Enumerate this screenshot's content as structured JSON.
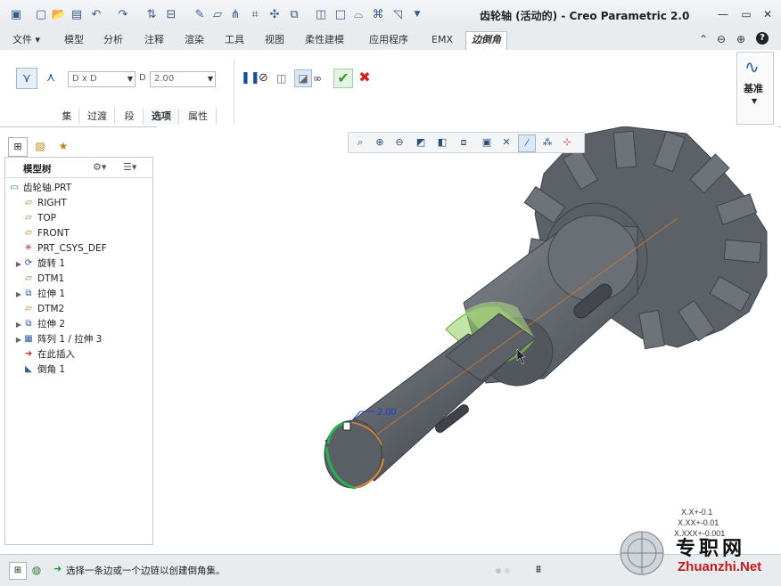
{
  "app": {
    "title": "齿轮轴 (活动的) - Creo Parametric 2.0"
  },
  "ribbon": {
    "file_label": "文件",
    "tabs": [
      "模型",
      "分析",
      "注释",
      "渲染",
      "工具",
      "视图",
      "柔性建模",
      "应用程序",
      "EMX"
    ],
    "active_tab": "边倒角"
  },
  "dashboard": {
    "dim_scheme": "D x D",
    "d_label": "D",
    "d_value": "2.00",
    "subtabs": [
      "集",
      "过渡",
      "段",
      "选项",
      "属性"
    ],
    "active_subtab": "选项",
    "datum_label": "基准"
  },
  "model_tree": {
    "tab_label": "模型树",
    "items": [
      {
        "label": "齿轮轴.PRT",
        "icon": "part-icon",
        "expandable": false
      },
      {
        "label": "RIGHT",
        "icon": "datum-plane-icon",
        "expandable": false
      },
      {
        "label": "TOP",
        "icon": "datum-plane-icon",
        "expandable": false
      },
      {
        "label": "FRONT",
        "icon": "datum-plane-icon",
        "expandable": false
      },
      {
        "label": "PRT_CSYS_DEF",
        "icon": "csys-icon",
        "expandable": false
      },
      {
        "label": "旋转 1",
        "icon": "revolve-icon",
        "expandable": true
      },
      {
        "label": "DTM1",
        "icon": "datum-plane-icon",
        "expandable": false
      },
      {
        "label": "拉伸 1",
        "icon": "extrude-icon",
        "expandable": true
      },
      {
        "label": "DTM2",
        "icon": "datum-plane-icon",
        "expandable": false
      },
      {
        "label": "拉伸 2",
        "icon": "extrude-icon",
        "expandable": true
      },
      {
        "label": "阵列 1 / 拉伸 3",
        "icon": "pattern-icon",
        "expandable": true
      },
      {
        "label": "在此插入",
        "icon": "insert-here-icon",
        "expandable": false
      },
      {
        "label": "倒角 1",
        "icon": "chamfer-icon",
        "expandable": false
      }
    ]
  },
  "viewport": {
    "dimension_label": "2.00",
    "precision_lines": [
      "X.X+-0.1",
      "X.XX+-0.01",
      "X.XXX+-0.001"
    ]
  },
  "status": {
    "message": "选择一条边或一个边链以创建倒角集。"
  },
  "watermark": {
    "text_cn": "专职网",
    "text_en": "Zhuanzhi.Net"
  },
  "colors": {
    "accent": "#2f5d9b",
    "model": "#5e6269",
    "highlight": "#9fe070",
    "confirm": "#2e9b2e",
    "cancel": "#d22424"
  }
}
